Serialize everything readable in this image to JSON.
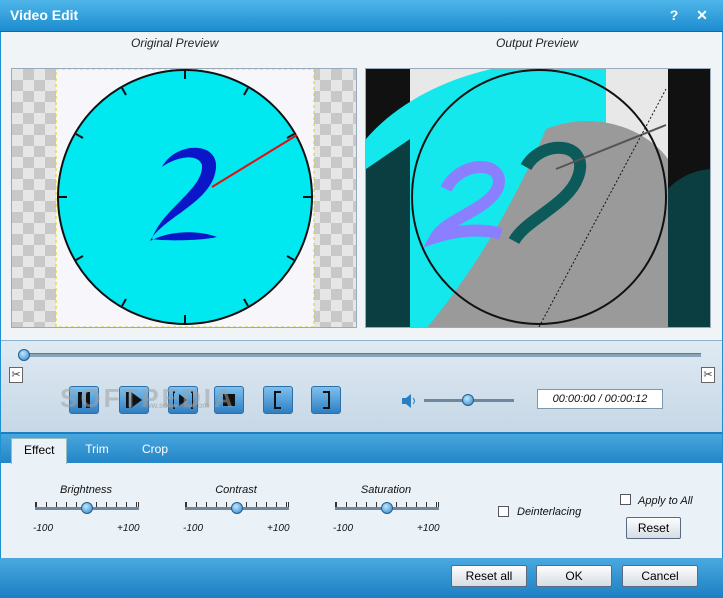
{
  "window": {
    "title": "Video Edit",
    "help_label": "?",
    "close_label": "✕"
  },
  "preview": {
    "original_label": "Original Preview",
    "output_label": "Output Preview"
  },
  "playback": {
    "time": "00:00:00 / 00:00:12",
    "position": 0.0,
    "volume": 0.5
  },
  "watermark": {
    "text": "SOFTPEDIA",
    "sub": "www.softpedia.com"
  },
  "tabs": [
    {
      "label": "Effect"
    },
    {
      "label": "Trim"
    },
    {
      "label": "Crop"
    }
  ],
  "effect": {
    "brightness": {
      "label": "Brightness",
      "min": "-100",
      "max": "+100",
      "value": 0
    },
    "contrast": {
      "label": "Contrast",
      "min": "-100",
      "max": "+100",
      "value": 0
    },
    "saturation": {
      "label": "Saturation",
      "min": "-100",
      "max": "+100",
      "value": 0
    },
    "deinterlacing_label": "Deinterlacing",
    "apply_all_label": "Apply to All",
    "reset_label": "Reset"
  },
  "footer": {
    "reset_all_label": "Reset all",
    "ok_label": "OK",
    "cancel_label": "Cancel"
  },
  "colors": {
    "accent": "#1e8fd0",
    "clock_face": "#00e5ee",
    "digit": "#0a16c8",
    "hand": "#e01010"
  }
}
